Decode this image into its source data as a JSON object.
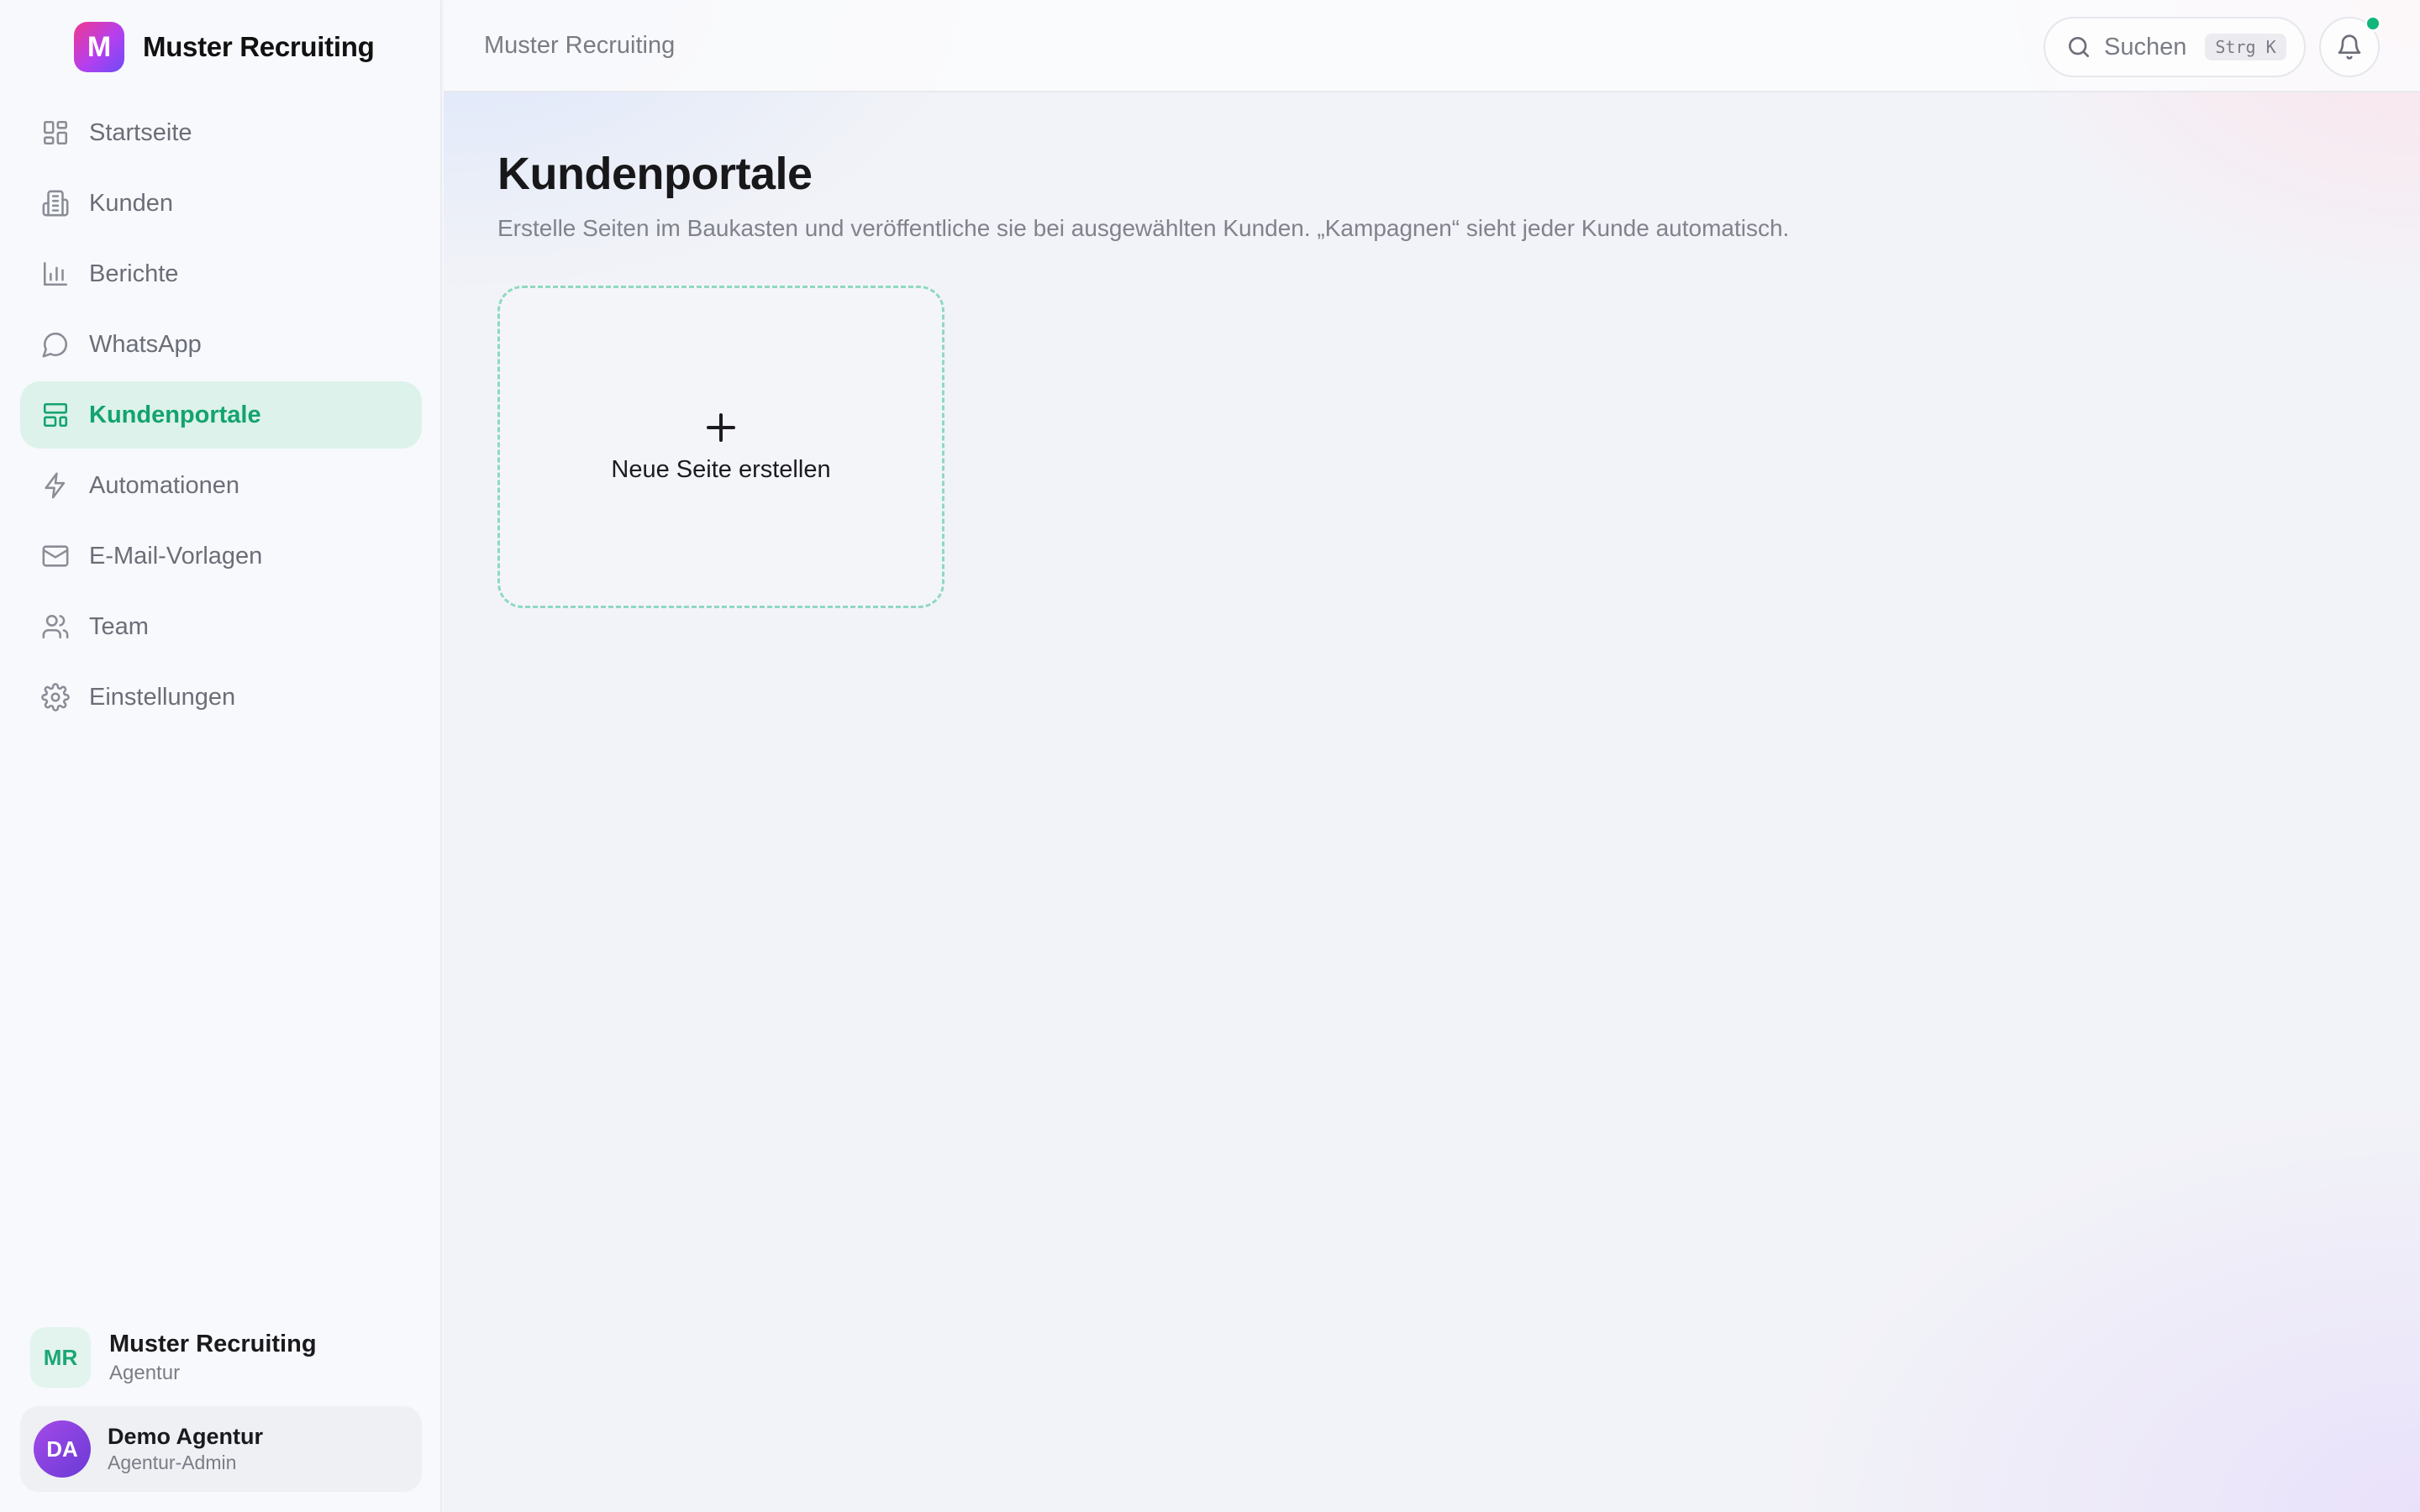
{
  "brand": {
    "logo_letter": "M",
    "name": "Muster Recruiting"
  },
  "sidebar": {
    "items": [
      {
        "label": "Startseite",
        "icon": "grid-icon"
      },
      {
        "label": "Kunden",
        "icon": "building-icon"
      },
      {
        "label": "Berichte",
        "icon": "bar-chart-icon"
      },
      {
        "label": "WhatsApp",
        "icon": "chat-bubble-icon"
      },
      {
        "label": "Kundenportale",
        "icon": "layout-icon",
        "active": true
      },
      {
        "label": "Automationen",
        "icon": "lightning-icon"
      },
      {
        "label": "E-Mail-Vorlagen",
        "icon": "mail-icon"
      },
      {
        "label": "Team",
        "icon": "users-icon"
      },
      {
        "label": "Einstellungen",
        "icon": "gear-icon"
      }
    ]
  },
  "org": {
    "initials": "MR",
    "name": "Muster Recruiting",
    "role": "Agentur"
  },
  "user": {
    "initials": "DA",
    "name": "Demo Agentur",
    "role": "Agentur-Admin"
  },
  "topbar": {
    "title": "Muster Recruiting",
    "search_label": "Suchen",
    "search_shortcut": "Strg K"
  },
  "main": {
    "title": "Kundenportale",
    "subtitle": "Erstelle Seiten im Baukasten und veröffentliche sie bei ausgewählten Kunden. „Kampagnen“ sieht jeder Kunde automatisch.",
    "new_page_label": "Neue Seite erstellen"
  },
  "colors": {
    "accent": "#13a36f",
    "active_bg": "#dcf2ea",
    "notification_dot": "#12b57a"
  }
}
